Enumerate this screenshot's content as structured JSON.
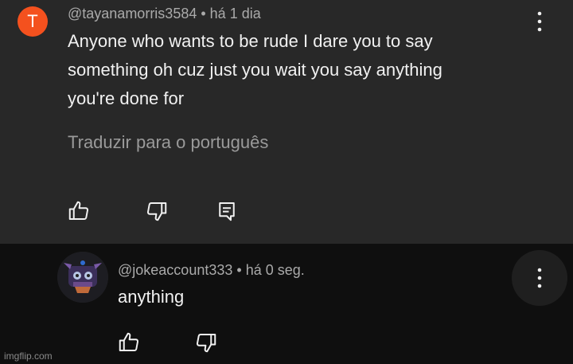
{
  "comments": [
    {
      "avatar_letter": "T",
      "avatar_color": "#f4511e",
      "handle": "@tayanamorris3584",
      "time": "há 1 dia",
      "text_lines": [
        "Anyone who wants to be rude I dare you to say",
        "something oh cuz just you wait you say anything",
        "you're done for"
      ],
      "translate_label": "Traduzir para o português",
      "actions": [
        "thumbs-up-icon",
        "thumbs-down-icon",
        "reply-icon"
      ]
    },
    {
      "avatar_icon": "dark-mask-avatar",
      "handle": "@jokeaccount333",
      "time": "há 0 seg.",
      "text": "anything",
      "actions": [
        "thumbs-up-icon",
        "thumbs-down-icon"
      ]
    }
  ],
  "separator": "•",
  "watermark": "imgflip.com",
  "colors": {
    "top_comment_bg": "#282828",
    "page_bg": "#0f0f0f",
    "text": "#f1f1f1",
    "meta": "#aaaaaa"
  }
}
